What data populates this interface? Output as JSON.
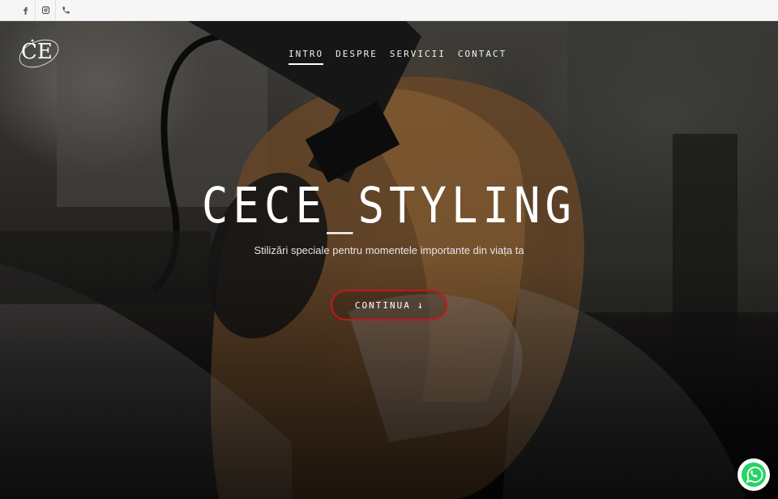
{
  "social": [
    {
      "icon": "facebook-icon"
    },
    {
      "icon": "instagram-icon"
    },
    {
      "icon": "phone-icon"
    }
  ],
  "logo": {
    "letters": "CE"
  },
  "nav": [
    {
      "label": "INTRO",
      "active": true
    },
    {
      "label": "DESPRE",
      "active": false
    },
    {
      "label": "SERVICII",
      "active": false
    },
    {
      "label": "CONTACT",
      "active": false
    }
  ],
  "hero": {
    "title": "CECE_STYLING",
    "subtitle": "Stilizări speciale pentru momentele importante din viața ta",
    "cta_label": "CONTINUA",
    "cta_icon": "arrow-down-icon"
  },
  "colors": {
    "accent": "#c8141e",
    "topbar_bg": "#f6f6f6",
    "whatsapp": "#25d366"
  },
  "floating": {
    "icon": "whatsapp-icon"
  }
}
